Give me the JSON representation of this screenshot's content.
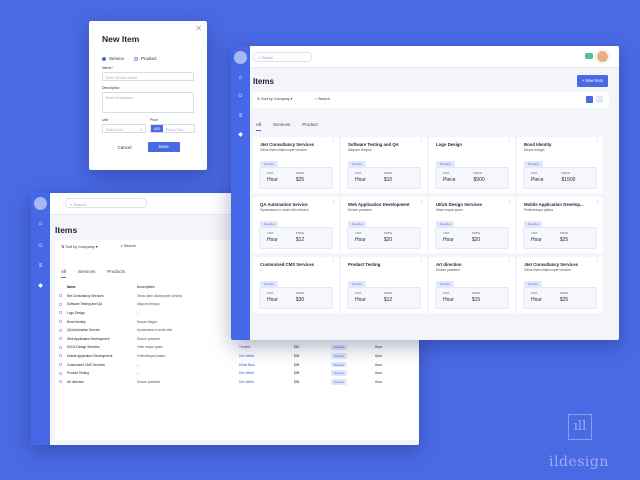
{
  "modal": {
    "title": "New Item",
    "close": "✕",
    "radio_service": "Service",
    "radio_product": "Product",
    "name_label": "Name*",
    "name_placeholder": "Enter Service Name",
    "desc_label": "Description",
    "desc_placeholder": "Enter Description",
    "unit_label": "Unit",
    "unit_value": "Select Unit",
    "price_label": "Price",
    "currency": "USD",
    "price_placeholder": "Enter Price",
    "cancel": "Cancel",
    "save": "Save"
  },
  "back": {
    "search": "Search",
    "title": "Items",
    "sort": "Sort by Company",
    "search2": "Search",
    "tabs": [
      "All",
      "Services",
      "Products"
    ],
    "headers": [
      "Name",
      "Description",
      "",
      "",
      "",
      ""
    ],
    "rows": [
      {
        "name": "Net Consultancy Services",
        "desc": "Tellus diam ullamcorper ultricies",
        "c3": "",
        "c4": "",
        "c5": "",
        "c6": ""
      },
      {
        "name": "Software Testing and QA",
        "desc": "Aliquam tempus",
        "c3": "",
        "c4": "",
        "c5": "",
        "c6": ""
      },
      {
        "name": "Logo Design",
        "desc": "–",
        "c3": "",
        "c4": "",
        "c5": "",
        "c6": ""
      },
      {
        "name": "Bond Identity",
        "desc": "Neque integer",
        "c3": "",
        "c4": "",
        "c5": "",
        "c6": ""
      },
      {
        "name": "QA Automation Service",
        "desc": "Hymenaeos in amet nibh",
        "c3": "",
        "c4": "",
        "c5": "",
        "c6": ""
      },
      {
        "name": "Web Application Development",
        "desc": "Dictum praesent",
        "c3": "",
        "c4": "",
        "c5": "",
        "c6": ""
      },
      {
        "name": "UI/UX Design Services",
        "desc": "Vitae neque quam",
        "c3": "Trendtix",
        "c4": "$20",
        "c5": "Service",
        "c6": "Hour"
      },
      {
        "name": "Mobile Application Development",
        "desc": "Pellentesque platea",
        "c3": "Dee Webb",
        "c4": "$36",
        "c5": "Service",
        "c6": "Hour"
      },
      {
        "name": "Customized CMS Services",
        "desc": "–",
        "c3": "Ethan Bros",
        "c4": "$36",
        "c5": "Service",
        "c6": "Hour"
      },
      {
        "name": "Product Testing",
        "desc": "–",
        "c3": "Dee Webb",
        "c4": "$36",
        "c5": "Service",
        "c6": "Hour"
      },
      {
        "name": "Art direction",
        "desc": "Dictum praesent",
        "c3": "Dee Webb",
        "c4": "$36",
        "c5": "Service",
        "c6": "Hour"
      }
    ]
  },
  "front": {
    "search": "Search",
    "title": "Items",
    "new_item": "+ New Item",
    "sort": "Sort by Company",
    "search2": "Search",
    "tabs": [
      "All",
      "Services",
      "Product"
    ],
    "unit_key": "UNIT",
    "price_key": "PRICE",
    "cards": [
      {
        "name": ".Net Consultancy Services",
        "sub": "Tellus diam ullamcorper ultricies",
        "tag": "Service",
        "unit": "Hour",
        "price": "$25"
      },
      {
        "name": "Software Testing and QA",
        "sub": "Aliquam tempus",
        "tag": "Service",
        "unit": "Hour",
        "price": "$10"
      },
      {
        "name": "Logo Design",
        "sub": "",
        "tag": "Product",
        "unit": "Piece",
        "price": "$900"
      },
      {
        "name": "Bond Identity",
        "sub": "Neque integer",
        "tag": "Product",
        "unit": "Piece",
        "price": "$1500"
      },
      {
        "name": "QA Automation Service",
        "sub": "Hymenaeos in amet nibh ultricies",
        "tag": "Service",
        "unit": "Hour",
        "price": "$12"
      },
      {
        "name": "Web Application Development",
        "sub": "Dictum praesent",
        "tag": "Service",
        "unit": "Hour",
        "price": "$20"
      },
      {
        "name": "UI/UX Design Services",
        "sub": "Vitae neque quam",
        "tag": "Service",
        "unit": "Hour",
        "price": "$20"
      },
      {
        "name": "Mobile Application Develop...",
        "sub": "Pellentesque platea",
        "tag": "Service",
        "unit": "Hour",
        "price": "$25"
      },
      {
        "name": "Customized CMS Services",
        "sub": "–",
        "tag": "Service",
        "unit": "Hour",
        "price": "$30"
      },
      {
        "name": "Product Testing",
        "sub": "–",
        "tag": "Service",
        "unit": "Hour",
        "price": "$12"
      },
      {
        "name": "Art direction",
        "sub": "Dictum praesent",
        "tag": "Service",
        "unit": "Hour",
        "price": "$15"
      },
      {
        "name": ".Net Consultancy Services",
        "sub": "Tellus diam ullamcorper ultricies",
        "tag": "Service",
        "unit": "Hour",
        "price": "$25"
      }
    ]
  },
  "brand": "ildesign",
  "colors": {
    "accent": "#4a6ae4",
    "background": "#4a6ae4",
    "badge_bg": "#dfe6fd"
  }
}
